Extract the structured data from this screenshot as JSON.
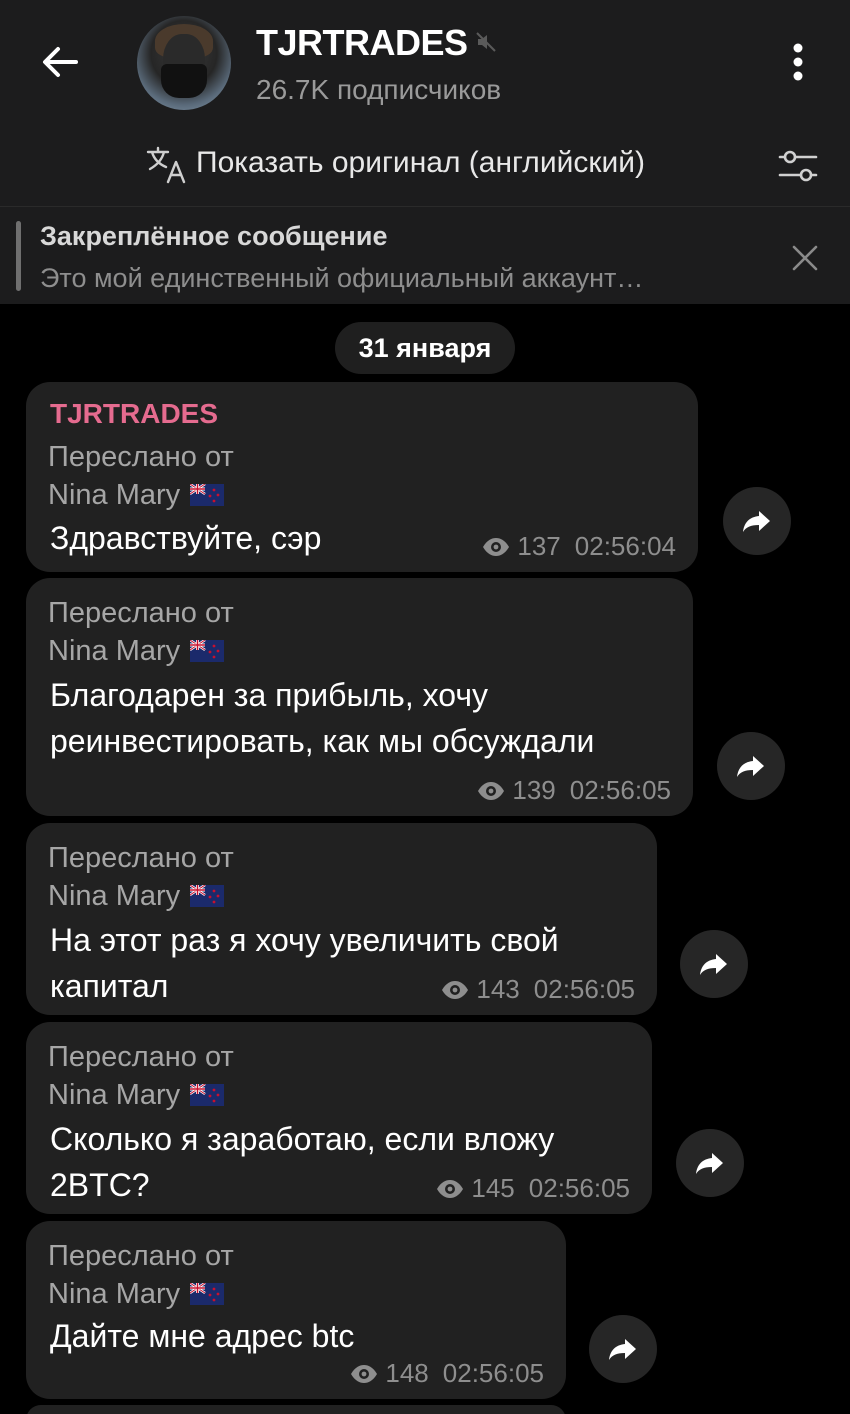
{
  "header": {
    "title": "TJRTRADES",
    "subtitle": "26.7K подписчиков"
  },
  "translate": {
    "label": "Показать оригинал (английский)"
  },
  "pinned": {
    "title": "Закреплённое сообщение",
    "text": "Это мой единственный официальный аккаунт…"
  },
  "date": "31 января",
  "messages": [
    {
      "sender": "TJRTRADES",
      "forwarded_label": "Переслано от",
      "forwarded_name": "Nina Mary",
      "text_lines": [
        "Здравствуйте, сэр"
      ],
      "views": "137",
      "time": "02:56:04"
    },
    {
      "forwarded_label": "Переслано от",
      "forwarded_name": "Nina Mary",
      "text_lines": [
        "Благодарен за прибыль, хочу",
        "реинвестировать, как мы обсуждали"
      ],
      "views": "139",
      "time": "02:56:05"
    },
    {
      "forwarded_label": "Переслано от",
      "forwarded_name": "Nina Mary",
      "text_lines": [
        "На этот раз я хочу увеличить свой",
        "капитал"
      ],
      "views": "143",
      "time": "02:56:05"
    },
    {
      "forwarded_label": "Переслано от",
      "forwarded_name": "Nina Mary",
      "text_lines": [
        "Сколько я заработаю, если вложу",
        "2BTC?"
      ],
      "views": "145",
      "time": "02:56:05"
    },
    {
      "forwarded_label": "Переслано от",
      "forwarded_name": "Nina Mary",
      "text_lines": [
        "Дайте мне адрес btc"
      ],
      "views": "148",
      "time": "02:56:05"
    }
  ],
  "icons": {
    "back": "arrow-left-icon",
    "mute": "muted-icon",
    "menu": "more-vertical-icon",
    "translate": "translate-icon",
    "filter": "settings-sliders-icon",
    "close": "close-icon",
    "views": "eye-icon",
    "share": "share-arrow-icon",
    "flag": "new-zealand-flag-icon"
  },
  "colors": {
    "sender": "#e56b8f",
    "bubble": "#212121",
    "header": "#1c1c1d"
  }
}
